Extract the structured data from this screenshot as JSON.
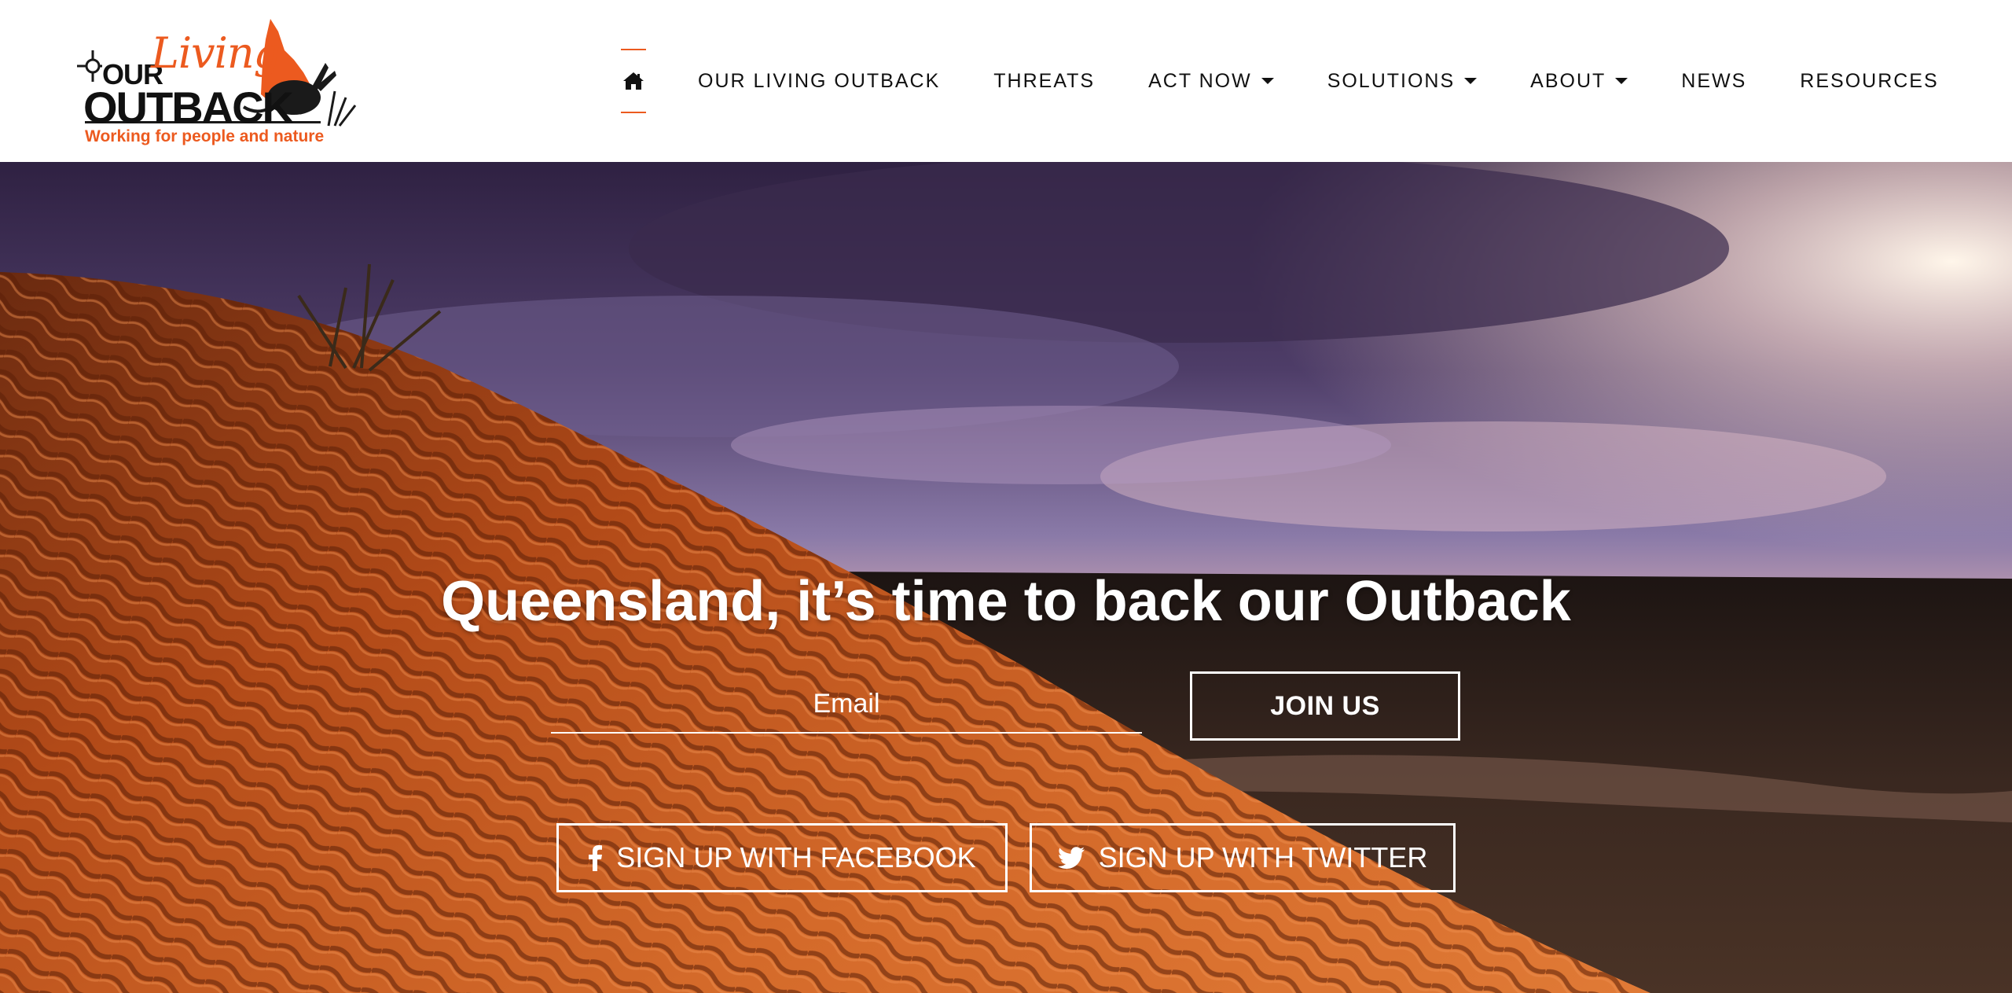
{
  "logo": {
    "line1_our": "OUR",
    "line1_living": "Living",
    "line2": "OUTBACK",
    "tagline": "Working for people and nature"
  },
  "nav": {
    "home_icon": "home-icon",
    "items": [
      {
        "label": "OUR LIVING OUTBACK",
        "dropdown": false
      },
      {
        "label": "THREATS",
        "dropdown": false
      },
      {
        "label": "ACT NOW",
        "dropdown": true
      },
      {
        "label": "SOLUTIONS",
        "dropdown": true
      },
      {
        "label": "ABOUT",
        "dropdown": true
      },
      {
        "label": "NEWS",
        "dropdown": false
      },
      {
        "label": "RESOURCES",
        "dropdown": false
      }
    ]
  },
  "hero": {
    "headline": "Queensland, it’s time to back our Outback",
    "email_placeholder": "Email",
    "join_label": "JOIN US",
    "facebook_label": "SIGN UP WITH FACEBOOK",
    "twitter_label": "SIGN UP WITH TWITTER",
    "facebook_icon": "facebook-icon",
    "twitter_icon": "twitter-icon"
  },
  "colors": {
    "accent": "#ec5a1f",
    "nav_text": "#111111",
    "hero_text": "#ffffff"
  }
}
